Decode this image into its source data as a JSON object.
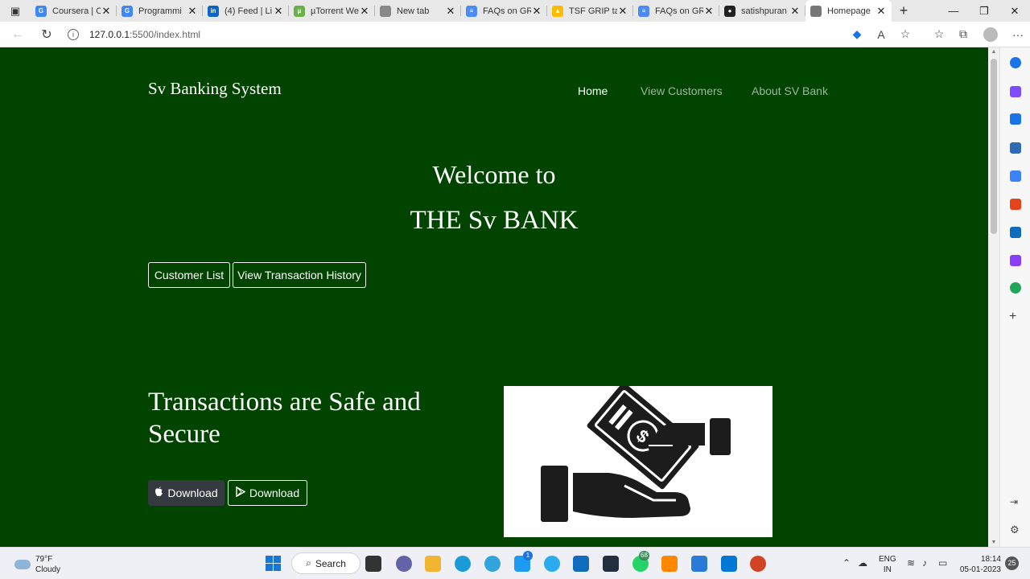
{
  "browser": {
    "tabs": [
      {
        "title": "Coursera | O",
        "icon": "google-icon",
        "color": "#4285f4",
        "glyph": "G"
      },
      {
        "title": "Programmi",
        "icon": "google-icon",
        "color": "#4285f4",
        "glyph": "G"
      },
      {
        "title": "(4) Feed | Li",
        "icon": "linkedin-icon",
        "color": "#0a66c2",
        "glyph": "in"
      },
      {
        "title": "µTorrent We",
        "icon": "utorrent-icon",
        "color": "#6ab04c",
        "glyph": "µ"
      },
      {
        "title": "New tab",
        "icon": "newtab-icon",
        "color": "#888888",
        "glyph": ""
      },
      {
        "title": "FAQs on GR",
        "icon": "docs-icon",
        "color": "#4c8bf5",
        "glyph": "≡"
      },
      {
        "title": "TSF GRIP ta",
        "icon": "drive-icon",
        "color": "#fbbc04",
        "glyph": "▲"
      },
      {
        "title": "FAQs on GR",
        "icon": "docs-icon",
        "color": "#4c8bf5",
        "glyph": "≡"
      },
      {
        "title": "satishpuran",
        "icon": "github-icon",
        "color": "#222222",
        "glyph": "●"
      },
      {
        "title": "Homepage",
        "icon": "page-icon",
        "color": "#777777",
        "glyph": ""
      }
    ],
    "url_host": "127.0.0.1",
    "url_path": ":5500/index.html"
  },
  "page": {
    "brand": "Sv Banking System",
    "nav": {
      "home": "Home",
      "customers": "View Customers",
      "about": "About SV Bank"
    },
    "hero_line1": "Welcome to",
    "hero_line2": "THE Sv BANK",
    "btn_customer_list": "Customer List",
    "btn_transaction_history": "View Transaction History",
    "section_title": "Transactions are Safe and Secure",
    "download_apple": "Download",
    "download_play": "Download"
  },
  "taskbar": {
    "weather_temp": "79°F",
    "weather_desc": "Cloudy",
    "search": "Search",
    "twitter_badge": "1",
    "whatsapp_badge": "68",
    "lang1": "ENG",
    "lang2": "IN",
    "time": "18:14",
    "date": "05-01-2023",
    "notifications": "25"
  },
  "colors": {
    "page_bg": "#004400",
    "nav_inactive": "#9db59d",
    "dark_button": "#343a40"
  }
}
